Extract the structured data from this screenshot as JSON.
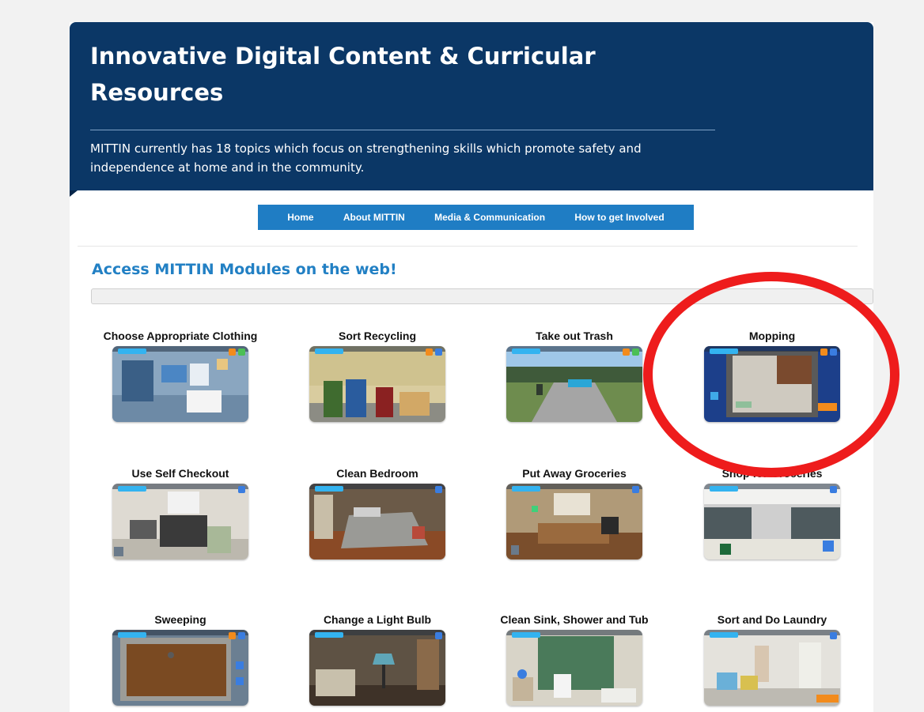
{
  "hero": {
    "title": "Innovative Digital Content & Curricular Resources",
    "description": "MITTIN currently has 18 topics which focus on strengthening skills which promote safety and independence at home and in the community."
  },
  "nav": {
    "items": [
      "Home",
      "About MITTIN",
      "Media & Communication",
      "How to get Involved"
    ]
  },
  "section": {
    "heading": "Access MITTIN Modules on the web!"
  },
  "modules": [
    {
      "title": "Choose Appropriate Clothing",
      "scene": "bedroom-closet"
    },
    {
      "title": "Sort Recycling",
      "scene": "recycling-bins"
    },
    {
      "title": "Take out Trash",
      "scene": "outdoor-driveway"
    },
    {
      "title": "Mopping",
      "scene": "floor-topdown"
    },
    {
      "title": "Use Self Checkout",
      "scene": "checkout-kiosk"
    },
    {
      "title": "Clean Bedroom",
      "scene": "bedroom-bed"
    },
    {
      "title": "Put Away Groceries",
      "scene": "kitchen-dining"
    },
    {
      "title": "Shop for Groceries",
      "scene": "grocery-store"
    },
    {
      "title": "Sweeping",
      "scene": "floor-wood"
    },
    {
      "title": "Change a Light Bulb",
      "scene": "living-room-lamp"
    },
    {
      "title": "Clean Sink, Shower and Tub",
      "scene": "bathroom"
    },
    {
      "title": "Sort and Do Laundry",
      "scene": "laundry-room"
    }
  ],
  "annotation": {
    "color": "#ee1c1c",
    "target": "Mopping"
  },
  "colors": {
    "hero_bg": "#0b3766",
    "nav_bg": "#1f7dc4",
    "heading": "#2280c4"
  }
}
